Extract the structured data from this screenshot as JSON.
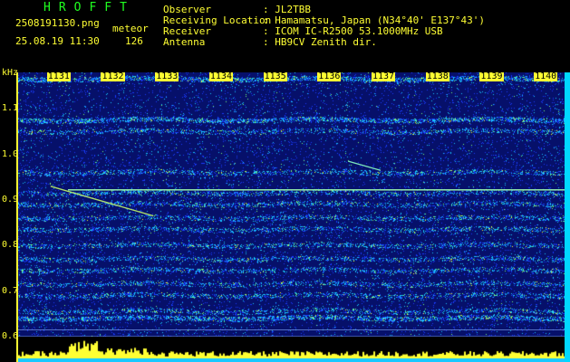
{
  "header": {
    "app_title": "HROFFT",
    "file_name": "2508191130.png",
    "datetime": "25.08.19 11:30",
    "mode": "meteor",
    "count": "126"
  },
  "station_info": [
    {
      "label": "Observer",
      "value": ": JL2TBB"
    },
    {
      "label": "Receiving Location",
      "value": ": Hamamatsu, Japan (N34°40' E137°43')"
    },
    {
      "label": "Receiver",
      "value": ": ICOM IC-R2500 53.1000MHz USB"
    },
    {
      "label": "Antenna",
      "value": ": HB9CV Zenith dir."
    }
  ],
  "spectrogram": {
    "y_axis_unit": "kHz",
    "y_ticks": [
      "1.1",
      "1.0",
      "0.9",
      "0.8",
      "0.7",
      "0.6"
    ],
    "y_range": [
      0.58,
      1.18
    ],
    "x_ticks": [
      "1131",
      "1132",
      "1133",
      "1134",
      "1135",
      "1136",
      "1137",
      "1138",
      "1139",
      "1140"
    ],
    "x_range": [
      1130.3,
      1140.4
    ],
    "colors": {
      "background": "#06106a",
      "noise_blue": "#1a3cff",
      "noise_cyan": "#19c8ff",
      "signal_green": "#7aff7a",
      "signal_yellow": "#ffff33",
      "carrier_line": "#9fffb0"
    }
  }
}
